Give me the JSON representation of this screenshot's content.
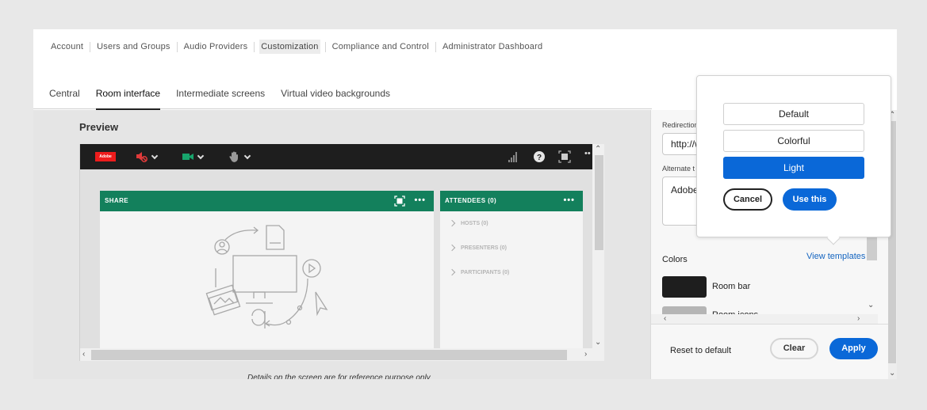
{
  "topnav": {
    "items": [
      "Account",
      "Users and Groups",
      "Audio Providers",
      "Customization",
      "Compliance and Control",
      "Administrator Dashboard"
    ],
    "active": "Customization"
  },
  "tabs": {
    "items": [
      "Central",
      "Room interface",
      "Intermediate screens",
      "Virtual video backgrounds"
    ],
    "active": "Room interface"
  },
  "preview": {
    "title": "Preview",
    "logo_text": "Adobe",
    "share_pod": {
      "title": "SHARE"
    },
    "attendees_pod": {
      "title": "ATTENDEES (0)",
      "groups": [
        "HOSTS (0)",
        "PRESENTERS (0)",
        "PARTICIPANTS (0)"
      ]
    },
    "disclaimer": "Details on the screen are for reference purpose only",
    "colors": {
      "room_bar": "#1e1e1e",
      "pod_header": "#13805c",
      "logo": "#ed1c1c"
    }
  },
  "settings": {
    "redirection_label": "Redirection",
    "redirection_value": "http://w",
    "alternate_label": "Alternate t",
    "alternate_value": "Adobe",
    "colors_label": "Colors",
    "view_templates": "View templates",
    "color_items": [
      {
        "label": "Room bar",
        "color": "#1e1e1e"
      },
      {
        "label": "Room icons",
        "color": "#b5b5b5"
      }
    ],
    "reset_label": "Reset to default",
    "clear_label": "Clear",
    "apply_label": "Apply"
  },
  "templates_popover": {
    "options": [
      "Default",
      "Colorful",
      "Light"
    ],
    "selected": "Light",
    "cancel_label": "Cancel",
    "use_label": "Use this"
  },
  "accent_color": "#0a68d8"
}
